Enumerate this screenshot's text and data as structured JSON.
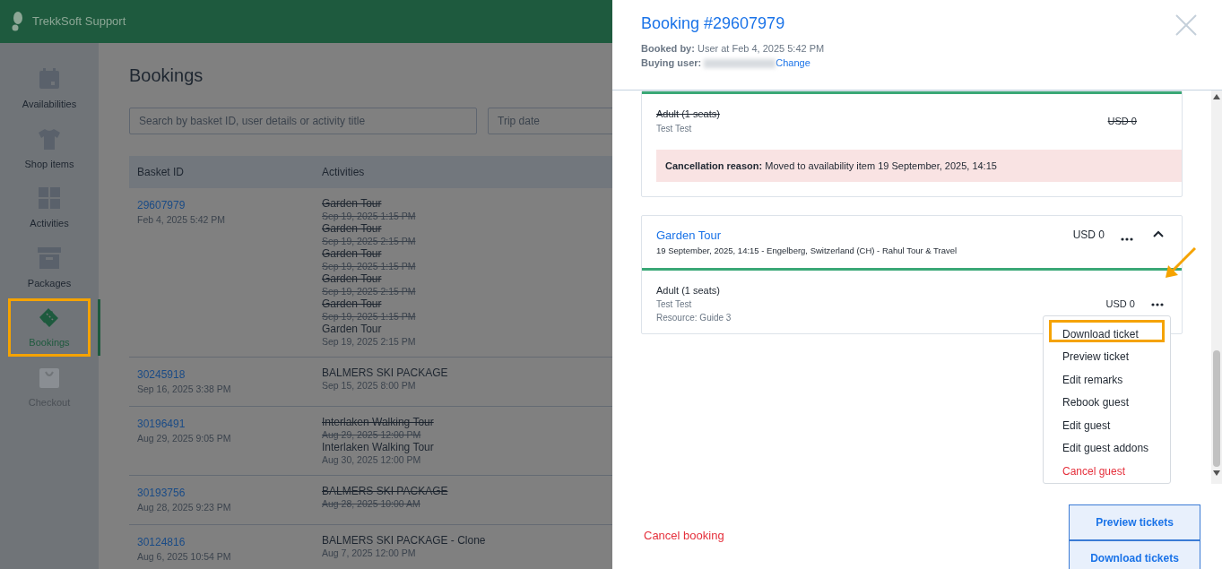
{
  "app": {
    "title": "TrekkSoft Support"
  },
  "sidebar": {
    "items": [
      {
        "label": "Availabilities",
        "selected": false,
        "disabled": false,
        "highlighted": false
      },
      {
        "label": "Shop items",
        "selected": false,
        "disabled": false,
        "highlighted": false
      },
      {
        "label": "Activities",
        "selected": false,
        "disabled": false,
        "highlighted": false
      },
      {
        "label": "Packages",
        "selected": false,
        "disabled": false,
        "highlighted": false
      },
      {
        "label": "Bookings",
        "selected": true,
        "disabled": false,
        "highlighted": true
      },
      {
        "label": "Checkout",
        "selected": false,
        "disabled": true,
        "highlighted": false
      }
    ]
  },
  "page": {
    "title": "Bookings",
    "search": {
      "placeholder": "Search by basket ID, user details or activity title"
    },
    "date_filter": {
      "placeholder": "Trip date"
    }
  },
  "table": {
    "columns": [
      "Basket ID",
      "Activities"
    ],
    "rows": [
      {
        "basket_id": "29607979",
        "created": "Feb 4, 2025 5:42 PM",
        "activities": [
          {
            "name": "Garden Tour",
            "date": "Sep 19, 2025 1:15 PM",
            "cancelled": true
          },
          {
            "name": "Garden Tour",
            "date": "Sep 19, 2025 2:15 PM",
            "cancelled": true
          },
          {
            "name": "Garden Tour",
            "date": "Sep 19, 2025 1:15 PM",
            "cancelled": true
          },
          {
            "name": "Garden Tour",
            "date": "Sep 19, 2025 2:15 PM",
            "cancelled": true
          },
          {
            "name": "Garden Tour",
            "date": "Sep 19, 2025 1:15 PM",
            "cancelled": true
          },
          {
            "name": "Garden Tour",
            "date": "Sep 19, 2025 2:15 PM",
            "cancelled": false
          }
        ]
      },
      {
        "basket_id": "30245918",
        "created": "Sep 16, 2025 3:38 PM",
        "activities": [
          {
            "name": "BALMERS SKI PACKAGE",
            "date": "Sep 15, 2025 8:00 PM",
            "cancelled": false
          }
        ]
      },
      {
        "basket_id": "30196491",
        "created": "Aug 29, 2025 9:05 PM",
        "activities": [
          {
            "name": "Interlaken Walking Tour",
            "date": "Aug 29, 2025 12:00 PM",
            "cancelled": true
          },
          {
            "name": "Interlaken Walking Tour",
            "date": "Aug 30, 2025 12:00 PM",
            "cancelled": false
          }
        ]
      },
      {
        "basket_id": "30193756",
        "created": "Aug 28, 2025 9:23 PM",
        "activities": [
          {
            "name": "BALMERS SKI PACKAGE",
            "date": "Aug 28, 2025 10:00 AM",
            "cancelled": true
          }
        ]
      },
      {
        "basket_id": "30124816",
        "created": "Aug 6, 2025 10:54 PM",
        "activities": [
          {
            "name": "BALMERS SKI PACKAGE - Clone",
            "date": "Aug 7, 2025 12:00 PM",
            "cancelled": false
          }
        ]
      }
    ]
  },
  "booking_panel": {
    "title": "Booking #29607979",
    "booked_by": {
      "label": "Booked by:",
      "value": "User at Feb 4, 2025 5:42 PM"
    },
    "buying_user": {
      "label": "Buying user:",
      "action": "Change"
    },
    "cards": [
      {
        "guests": [
          {
            "label": "Adult (1 seats)",
            "name": "Test Test",
            "price": "USD 0",
            "cancelled": true
          }
        ],
        "cancellation": {
          "label": "Cancellation reason:",
          "text": "Moved to availability item 19 September, 2025, 14:15"
        }
      },
      {
        "title": "Garden Tour",
        "subtitle": "19 September, 2025, 14:15 - Engelberg, Switzerland (CH) - Rahul Tour & Travel",
        "price": "USD 0",
        "expanded": true,
        "guests": [
          {
            "label": "Adult (1 seats)",
            "name": "Test Test",
            "resource": "Resource: Guide 3",
            "price": "USD 0",
            "cancelled": false,
            "menu_open": true
          }
        ]
      }
    ],
    "guest_menu": [
      {
        "label": "Download ticket",
        "kind": "normal",
        "highlighted": true
      },
      {
        "label": "Preview ticket",
        "kind": "normal",
        "highlighted": false
      },
      {
        "label": "Edit remarks",
        "kind": "normal",
        "highlighted": false
      },
      {
        "label": "Rebook guest",
        "kind": "normal",
        "highlighted": false
      },
      {
        "label": "Edit guest",
        "kind": "normal",
        "highlighted": false
      },
      {
        "label": "Edit guest addons",
        "kind": "normal",
        "highlighted": false
      },
      {
        "label": "Cancel guest",
        "kind": "danger",
        "highlighted": false
      }
    ],
    "cancel_booking": "Cancel booking",
    "buttons": [
      "Preview tickets",
      "Download tickets"
    ]
  }
}
